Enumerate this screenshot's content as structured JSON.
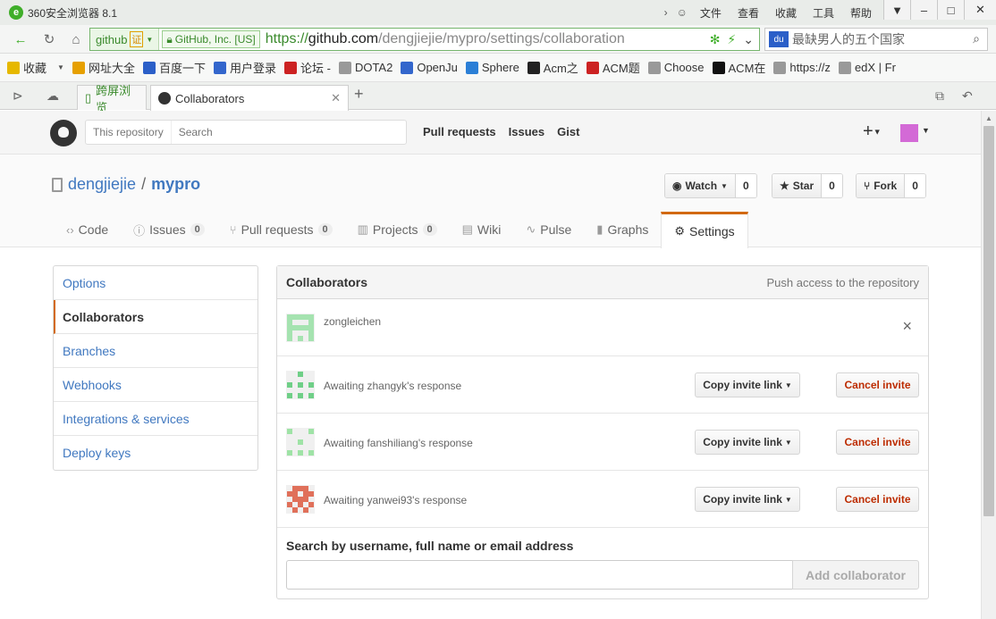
{
  "browser": {
    "title": "360安全浏览器 8.1",
    "menus": [
      "文件",
      "查看",
      "收藏",
      "工具",
      "帮助"
    ],
    "window_buttons": [
      "–",
      "□",
      "✕"
    ],
    "address": {
      "site_chip": "github",
      "site_badge": "证",
      "cert_label": "GitHub, Inc. [US]",
      "url_scheme": "https://",
      "url_host": "github.com",
      "url_path": "/dengjiejie/mypro/settings/collaboration"
    },
    "search": {
      "text": "最缺男人的五个国家"
    },
    "bookmarks": [
      {
        "label": "收藏",
        "icon": "star-icon",
        "color": "#e6b800"
      },
      {
        "label": "网址大全",
        "icon": "home-icon",
        "color": "#e6a000"
      },
      {
        "label": "百度一下",
        "icon": "paw-icon",
        "color": "#2b5fc8"
      },
      {
        "label": "用户登录",
        "icon": "globe-icon",
        "color": "#3366cc"
      },
      {
        "label": "论坛 -",
        "icon": "6v-icon",
        "color": "#cc2222"
      },
      {
        "label": "DOTA2",
        "icon": "page-icon",
        "color": "#999999"
      },
      {
        "label": "OpenJu",
        "icon": "poj-icon",
        "color": "#3366cc"
      },
      {
        "label": "Sphere",
        "icon": "s-icon",
        "color": "#2b7fd6"
      },
      {
        "label": "Acm之",
        "icon": "braces-icon",
        "color": "#222222"
      },
      {
        "label": "ACM题",
        "icon": "c-icon",
        "color": "#cc2222"
      },
      {
        "label": "Choose",
        "icon": "page-icon",
        "color": "#999999"
      },
      {
        "label": "ACM在",
        "icon": "icpc-icon",
        "color": "#111111"
      },
      {
        "label": "https://z",
        "icon": "page-icon",
        "color": "#999999"
      },
      {
        "label": "edX | Fr",
        "icon": "page-icon",
        "color": "#999999"
      }
    ],
    "tabs": [
      {
        "label": "跨屏浏览",
        "active": false
      },
      {
        "label": "Collaborators",
        "active": true
      }
    ]
  },
  "gh": {
    "scope": "This repository",
    "search_placeholder": "Search",
    "nav": [
      "Pull requests",
      "Issues",
      "Gist"
    ],
    "plus": "+"
  },
  "repo": {
    "owner": "dengjiejie",
    "sep": "/",
    "name": "mypro",
    "watch": {
      "label": "Watch",
      "count": "0"
    },
    "star": {
      "label": "Star",
      "count": "0"
    },
    "fork": {
      "label": "Fork",
      "count": "0"
    },
    "tabs": [
      {
        "label": "Code",
        "icon": "code-icon",
        "glyph": "‹›",
        "counter": ""
      },
      {
        "label": "Issues",
        "icon": "issue-icon",
        "glyph": "ⓘ",
        "counter": "0"
      },
      {
        "label": "Pull requests",
        "icon": "pull-request-icon",
        "glyph": "⑂",
        "counter": "0"
      },
      {
        "label": "Projects",
        "icon": "project-icon",
        "glyph": "▥",
        "counter": "0"
      },
      {
        "label": "Wiki",
        "icon": "book-icon",
        "glyph": "▤",
        "counter": ""
      },
      {
        "label": "Pulse",
        "icon": "pulse-icon",
        "glyph": "∿",
        "counter": ""
      },
      {
        "label": "Graphs",
        "icon": "graph-icon",
        "glyph": "▮",
        "counter": ""
      },
      {
        "label": "Settings",
        "icon": "gear-icon",
        "glyph": "⚙",
        "counter": ""
      }
    ]
  },
  "settings_menu": [
    "Options",
    "Collaborators",
    "Branches",
    "Webhooks",
    "Integrations & services",
    "Deploy keys"
  ],
  "collaborators": {
    "title": "Collaborators",
    "note": "Push access to the repository",
    "members": [
      {
        "name": "zongleichen",
        "color": "#a5e3b0"
      }
    ],
    "invites": [
      {
        "text": "Awaiting zhangyk's response",
        "color": "#6fcf87"
      },
      {
        "text": "Awaiting fanshiliang's response",
        "color": "#9fe3a6"
      },
      {
        "text": "Awaiting yanwei93's response",
        "color": "#e0705a"
      }
    ],
    "copy_label": "Copy invite link",
    "cancel_label": "Cancel invite",
    "remove_glyph": "×",
    "search_label": "Search by username, full name or email address",
    "search_value": "",
    "add_label": "Add collaborator"
  }
}
